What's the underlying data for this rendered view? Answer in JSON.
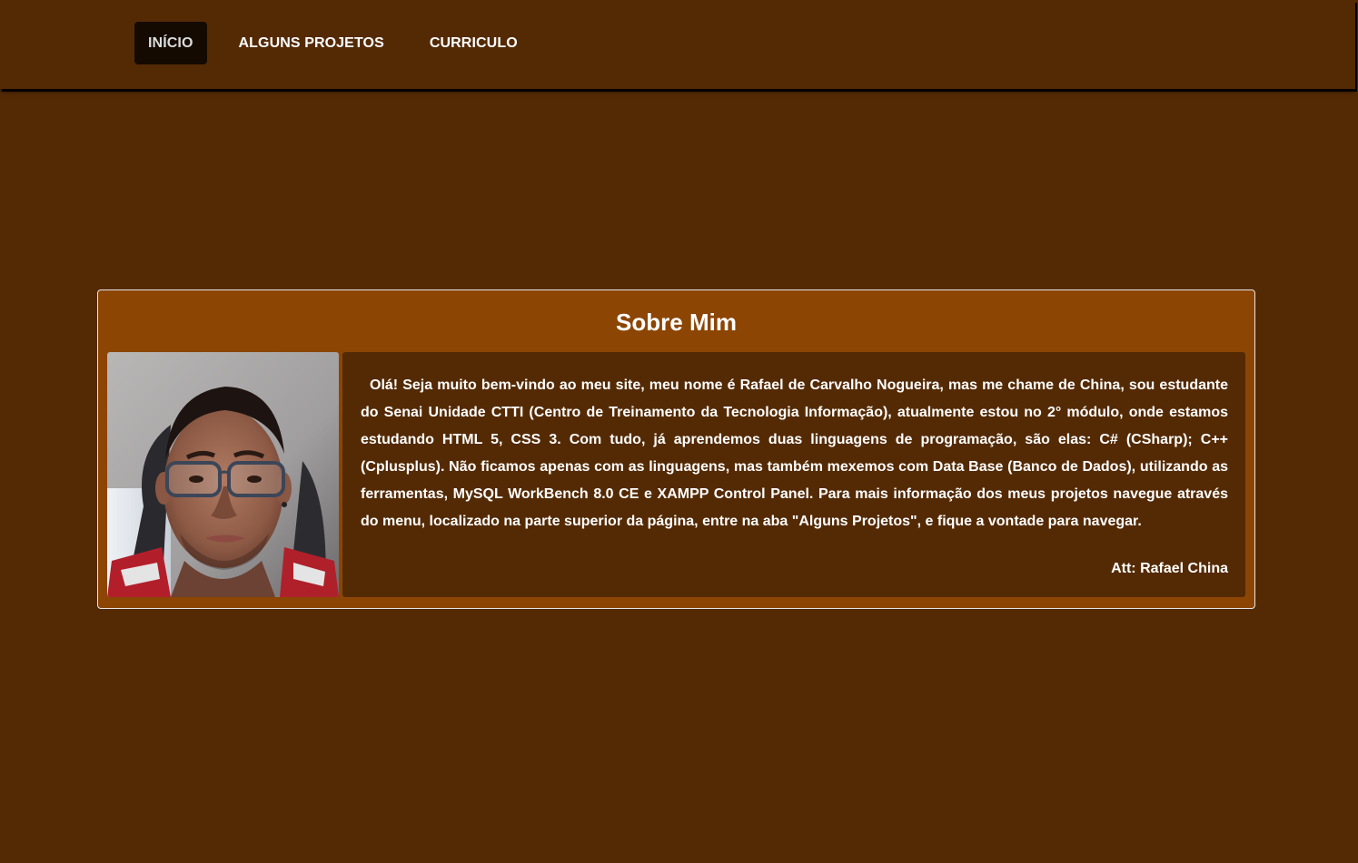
{
  "nav": {
    "items": [
      {
        "label": "INÍCIO",
        "active": true
      },
      {
        "label": "ALGUNS PROJETOS",
        "active": false
      },
      {
        "label": "CURRICULO",
        "active": false
      }
    ]
  },
  "about": {
    "title": "Sobre Mim",
    "photo_icon": "profile-photo",
    "bio": "Olá! Seja muito bem-vindo ao meu site, meu nome é Rafael de Carvalho Nogueira, mas me chame de China, sou estudante do Senai Unidade CTTI (Centro de Treinamento da Tecnologia Informação), atualmente estou no 2° módulo, onde estamos estudando HTML 5, CSS 3. Com tudo, já aprendemos duas linguagens de programação, são elas: C# (CSharp); C++ (Cplusplus). Não ficamos apenas com as linguagens, mas também mexemos com Data Base (Banco de Dados), utilizando as ferramentas, MySQL WorkBench 8.0 CE e XAMPP Control Panel. Para mais informação dos meus projetos navegue através do menu, localizado na parte superior da página, entre na aba \"Alguns Projetos\", e fique a vontade para navegar.",
    "signature": "Att: Rafael China"
  },
  "colors": {
    "page_background": "#542a04",
    "panel_background": "#8c4503",
    "active_nav_background": "#140a02",
    "text": "#ffffff"
  }
}
